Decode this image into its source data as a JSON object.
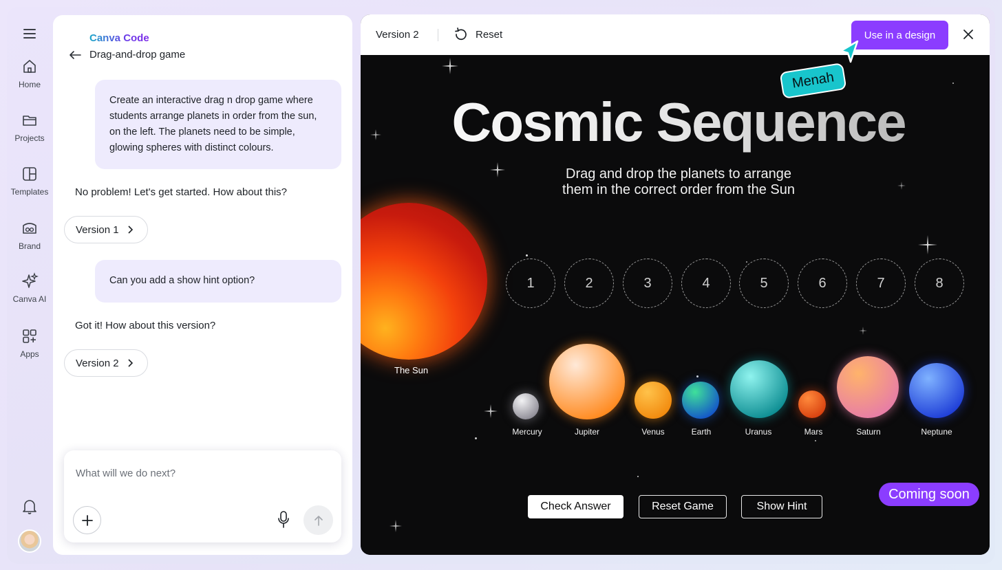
{
  "rail": {
    "items": [
      {
        "label": "Home",
        "icon": "home-icon"
      },
      {
        "label": "Projects",
        "icon": "folder-icon"
      },
      {
        "label": "Templates",
        "icon": "templates-icon"
      },
      {
        "label": "Brand",
        "icon": "brand-icon"
      },
      {
        "label": "Canva AI",
        "icon": "sparkle-icon"
      },
      {
        "label": "Apps",
        "icon": "apps-icon"
      }
    ]
  },
  "chat": {
    "brand": "Canva Code",
    "subtitle": "Drag-and-drop game",
    "messages": [
      {
        "role": "user",
        "text": "Create an interactive drag n drop game where students arrange planets in order from the sun, on the left. The planets need to be simple, glowing spheres with distinct colours."
      },
      {
        "role": "assistant",
        "text": "No problem! Let's get started. How about this?",
        "version": "Version 1"
      },
      {
        "role": "user",
        "text": "Can you add a show hint option?"
      },
      {
        "role": "assistant",
        "text": "Got it! How about this version?",
        "version": "Version 2"
      }
    ],
    "composer": {
      "placeholder": "What will we do next?"
    }
  },
  "preview": {
    "version_label": "Version 2",
    "reset_label": "Reset",
    "use_label": "Use in a design",
    "collaborator": "Menah",
    "game": {
      "title": "Cosmic Sequence",
      "subtitle_line1": "Drag and drop the planets to arrange",
      "subtitle_line2": "them in the correct order from the Sun",
      "sun_label": "The Sun",
      "slots": [
        "1",
        "2",
        "3",
        "4",
        "5",
        "6",
        "7",
        "8"
      ],
      "planets": [
        {
          "name": "Mercury",
          "colors": [
            "#f2f2f4",
            "#8e8c96"
          ]
        },
        {
          "name": "Jupiter",
          "colors": [
            "#ffe9d8",
            "#ff8a1f"
          ]
        },
        {
          "name": "Venus",
          "colors": [
            "#ffc24a",
            "#f28a0e"
          ]
        },
        {
          "name": "Earth",
          "colors": [
            "#3fe09a",
            "#1456c8"
          ]
        },
        {
          "name": "Uranus",
          "colors": [
            "#8ff3ee",
            "#0e8e93"
          ]
        },
        {
          "name": "Mars",
          "colors": [
            "#ff8a3c",
            "#d8410f"
          ]
        },
        {
          "name": "Saturn",
          "colors": [
            "#ffb36b",
            "#e77da6"
          ]
        },
        {
          "name": "Neptune",
          "colors": [
            "#7fb2ff",
            "#1f3fd8"
          ]
        }
      ],
      "buttons": {
        "check": "Check Answer",
        "reset": "Reset Game",
        "hint": "Show Hint"
      }
    },
    "badge": "Coming soon",
    "colors": {
      "accent": "#8b3dff",
      "teal": "#18c5cc"
    }
  }
}
